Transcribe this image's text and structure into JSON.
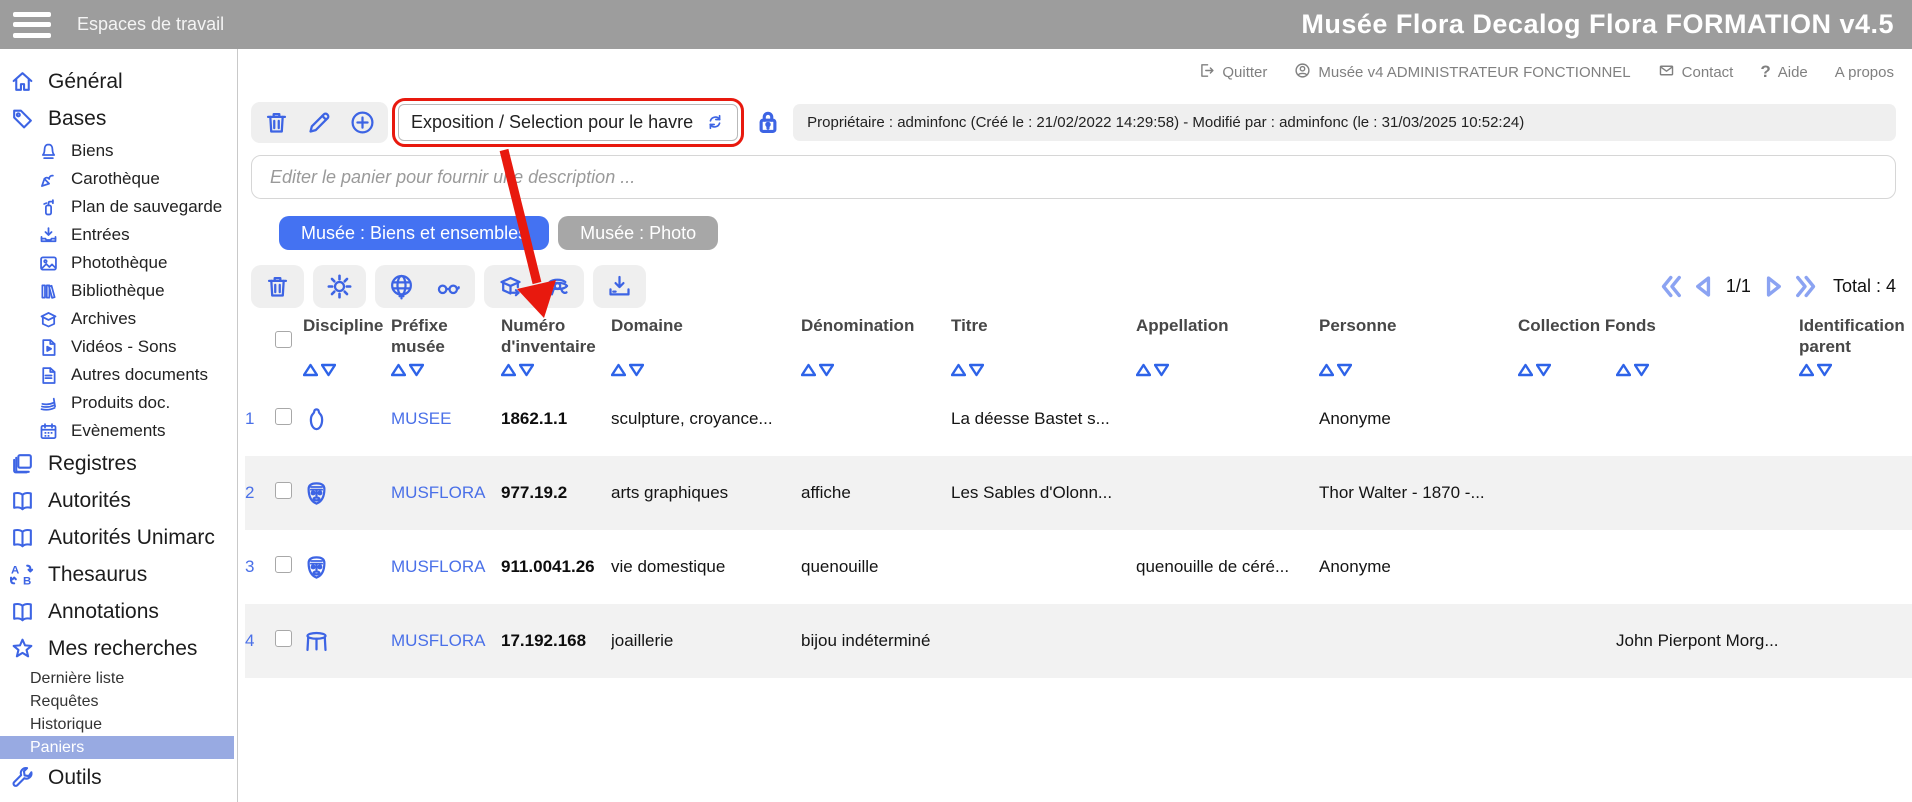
{
  "topbar": {
    "workspace_label": "Espaces de travail",
    "title": "Musée Flora Decalog Flora FORMATION v4.5"
  },
  "utility_bar": {
    "items": [
      {
        "label": "Quitter",
        "icon": "logout-icon"
      },
      {
        "label": "Musée v4 ADMINISTRATEUR FONCTIONNEL",
        "icon": "user-icon"
      },
      {
        "label": "Contact",
        "icon": "mail-icon"
      },
      {
        "label": "Aide",
        "icon": "question-icon"
      },
      {
        "label": "A propos",
        "icon": null
      }
    ]
  },
  "sidebar": {
    "items": [
      {
        "label": "Général",
        "level": 0,
        "icon": "home-icon",
        "selected": false
      },
      {
        "label": "Bases",
        "level": 0,
        "icon": "tag-icon",
        "selected": false
      },
      {
        "label": "Biens",
        "level": 1,
        "icon": "bell-icon",
        "selected": false
      },
      {
        "label": "Carothèque",
        "level": 1,
        "icon": "core-sample-icon",
        "selected": false
      },
      {
        "label": "Plan de sauvegarde",
        "level": 1,
        "icon": "fire-extinguisher-icon",
        "selected": false
      },
      {
        "label": "Entrées",
        "level": 1,
        "icon": "inbox-arrow-icon",
        "selected": false
      },
      {
        "label": "Photothèque",
        "level": 1,
        "icon": "photo-icon",
        "selected": false
      },
      {
        "label": "Bibliothèque",
        "level": 1,
        "icon": "books-icon",
        "selected": false
      },
      {
        "label": "Archives",
        "level": 1,
        "icon": "archive-box-icon",
        "selected": false
      },
      {
        "label": "Vidéos - Sons",
        "level": 1,
        "icon": "video-file-icon",
        "selected": false
      },
      {
        "label": "Autres documents",
        "level": 1,
        "icon": "document-icon",
        "selected": false
      },
      {
        "label": "Produits doc.",
        "level": 1,
        "icon": "paper-stack-icon",
        "selected": false
      },
      {
        "label": "Evènements",
        "level": 1,
        "icon": "calendar-icon",
        "selected": false
      },
      {
        "label": "Registres",
        "level": 0,
        "icon": "registers-icon",
        "selected": false
      },
      {
        "label": "Autorités",
        "level": 0,
        "icon": "open-book-icon",
        "selected": false
      },
      {
        "label": "Autorités Unimarc",
        "level": 0,
        "icon": "open-book-icon",
        "selected": false
      },
      {
        "label": "Thesaurus",
        "level": 0,
        "icon": "translate-icon",
        "selected": false
      },
      {
        "label": "Annotations",
        "level": 0,
        "icon": "open-book-icon",
        "selected": false
      },
      {
        "label": "Mes recherches",
        "level": 0,
        "icon": "star-icon",
        "selected": false
      },
      {
        "label": "Dernière liste",
        "level": 2,
        "icon": null,
        "selected": false
      },
      {
        "label": "Requêtes",
        "level": 2,
        "icon": null,
        "selected": false
      },
      {
        "label": "Historique",
        "level": 2,
        "icon": null,
        "selected": false
      },
      {
        "label": "Paniers",
        "level": 2,
        "icon": null,
        "selected": true
      },
      {
        "label": "Outils",
        "level": 0,
        "icon": "wrench-icon",
        "selected": false
      }
    ]
  },
  "basket_toolbar": {
    "actions": [
      "trash-icon",
      "pencil-icon",
      "add-circle-icon"
    ],
    "basket_select": {
      "value": "Exposition / Selection pour le havre",
      "icon": "refresh-icon"
    },
    "lock": "lock-icon",
    "owner_info": "Propriétaire : adminfonc (Créé le : 21/02/2022 14:29:58) - Modifié par : adminfonc (le : 31/03/2025 10:52:24)"
  },
  "description_input": {
    "value": "",
    "placeholder": "Editer le panier pour fournir une description ..."
  },
  "tabs": [
    {
      "label": "Musée : Biens et ensembles",
      "active": true
    },
    {
      "label": "Musée : Photo",
      "active": false
    }
  ],
  "list_toolbar": {
    "groups": [
      [
        "trash-icon"
      ],
      [
        "gear-icon"
      ],
      [
        "globe-icon",
        "glasses-icon"
      ],
      [
        "export-box-icon",
        "horus-eye-icon"
      ],
      [
        "download-icon"
      ]
    ]
  },
  "pagination": {
    "first": "double-chevron-left-icon",
    "prev": "triangle-left-icon",
    "page": "1/1",
    "next": "triangle-right-icon",
    "last": "double-chevron-right-icon",
    "total_label": "Total : 4"
  },
  "table": {
    "columns": [
      {
        "key": "num",
        "label": "",
        "sortable": false
      },
      {
        "key": "select",
        "label": "",
        "sortable": false,
        "checkbox": true
      },
      {
        "key": "discipline",
        "label": "Discipline",
        "sortable": true
      },
      {
        "key": "prefixe",
        "label": "Préfixe musée",
        "sortable": true
      },
      {
        "key": "numero",
        "label": "Numéro d'inventaire",
        "sortable": true
      },
      {
        "key": "domaine",
        "label": "Domaine",
        "sortable": true
      },
      {
        "key": "denomination",
        "label": "Dénomination",
        "sortable": true
      },
      {
        "key": "titre",
        "label": "Titre",
        "sortable": true
      },
      {
        "key": "appellation",
        "label": "Appellation",
        "sortable": true
      },
      {
        "key": "personne",
        "label": "Personne",
        "sortable": true
      },
      {
        "key": "collection",
        "label": "Collection Fonds",
        "sortable": true
      },
      {
        "key": "fonds",
        "label": "",
        "sortable": true
      },
      {
        "key": "identification",
        "label": "Identification parent",
        "sortable": true
      }
    ],
    "rows": [
      {
        "num": "1",
        "discipline_icon": "vase-icon",
        "prefixe": "MUSEE",
        "numero": "1862.1.1",
        "domaine": "sculpture, croyance...",
        "denomination": "",
        "titre": "La déesse Bastet s...",
        "appellation": "",
        "personne": "Anonyme",
        "collection": "",
        "fonds": "",
        "identification": ""
      },
      {
        "num": "2",
        "discipline_icon": "mask-icon",
        "prefixe": "MUSFLORA",
        "numero": "977.19.2",
        "domaine": "arts graphiques",
        "denomination": "affiche",
        "titre": "Les Sables d'Olonn...",
        "appellation": "",
        "personne": "Thor Walter - 1870 -...",
        "collection": "",
        "fonds": "",
        "identification": ""
      },
      {
        "num": "3",
        "discipline_icon": "mask-icon",
        "prefixe": "MUSFLORA",
        "numero": "911.0041.26",
        "domaine": "vie domestique",
        "denomination": "quenouille",
        "titre": "",
        "appellation": "quenouille de céré...",
        "personne": "Anonyme",
        "collection": "",
        "fonds": "",
        "identification": ""
      },
      {
        "num": "4",
        "discipline_icon": "stool-icon",
        "prefixe": "MUSFLORA",
        "numero": "17.192.168",
        "domaine": "joaillerie",
        "denomination": "bijou indéterminé",
        "titre": "",
        "appellation": "",
        "personne": "",
        "collection": "",
        "fonds": "John Pierpont Morg...",
        "identification": ""
      }
    ]
  },
  "colors": {
    "accent_blue": "#3D64E4",
    "link_blue": "#4a70e8",
    "tab_active": "#4472f2",
    "tab_inactive": "#a7a7a7",
    "topbar_gray": "#9d9d9d",
    "row_stripe": "#f2f2f2",
    "sidebar_selected": "#98aae2",
    "pagination_blue": "#8ba3f2",
    "annotation_red": "#e8190e"
  }
}
